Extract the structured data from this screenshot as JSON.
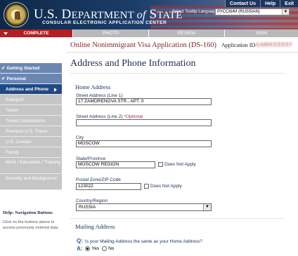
{
  "header": {
    "brand_us": "U.S. D",
    "brand_epartment": "EPARTMENT ",
    "brand_of": "of",
    "brand_state": " S",
    "brand_tate": "TATE",
    "brand_sub": "CONSULAR ELECTRONIC APPLICATION CENTER",
    "top_links": [
      "Contact Us",
      "Help",
      "Exit"
    ],
    "language_label": "Select Tooltip Language",
    "language_value": "РУССКИЙ (RUSSIAN)"
  },
  "progress": {
    "steps": [
      "COMPLETE",
      "PHOTO",
      "REVIEW",
      "SIGN"
    ],
    "active_step": "COMPLETE"
  },
  "app": {
    "title": "Online Nonimmigrant Visa Application (DS-160)",
    "id_label": "Application ID",
    "id_value": "AA00XXXXXX"
  },
  "sidebar": {
    "items": [
      {
        "label": "Getting Started",
        "state": "done"
      },
      {
        "label": "Personal",
        "state": "done"
      },
      {
        "label": "Address and Phone",
        "state": "active"
      },
      {
        "label": "Passport",
        "state": "pending"
      },
      {
        "label": "Travel",
        "state": "pending"
      },
      {
        "label": "Travel Companions",
        "state": "pending"
      },
      {
        "label": "Previous U.S. Travel",
        "state": "pending"
      },
      {
        "label": "U.S. Contact",
        "state": "pending"
      },
      {
        "label": "Family",
        "state": "pending"
      },
      {
        "label": "Work / Education / Training",
        "state": "pending"
      },
      {
        "label": "Security and Background",
        "state": "pending"
      }
    ],
    "help_title": "Help: Navigation Buttons",
    "help_text": "Click on the buttons above to access previously entered data."
  },
  "main": {
    "page_title": "Address and Phone Information",
    "home_section": "Home Address",
    "street1_label": "Street Address (Line 1)",
    "street1_value": "17 ZAMORENOVA STR., APT. 0",
    "street2_label": "Street Address (Line 2)",
    "street2_optional": "*Optional",
    "street2_value": "",
    "city_label": "City",
    "city_value": "MOSCOW",
    "state_label": "State/Province",
    "state_value": "MOSCOW REGION",
    "does_not_apply": "Does Not Apply",
    "zip_label": "Postal Zone/ZIP Code",
    "zip_value": "123022",
    "country_label": "Country/Region",
    "country_value": "RUSSIA",
    "mailing_section": "Mailing Address",
    "q_mark": "Q:",
    "question": "Is your Mailing Address the same as your Home Address?",
    "a_mark": "A:",
    "yes": "Yes",
    "no": "No",
    "selected": "Yes"
  }
}
